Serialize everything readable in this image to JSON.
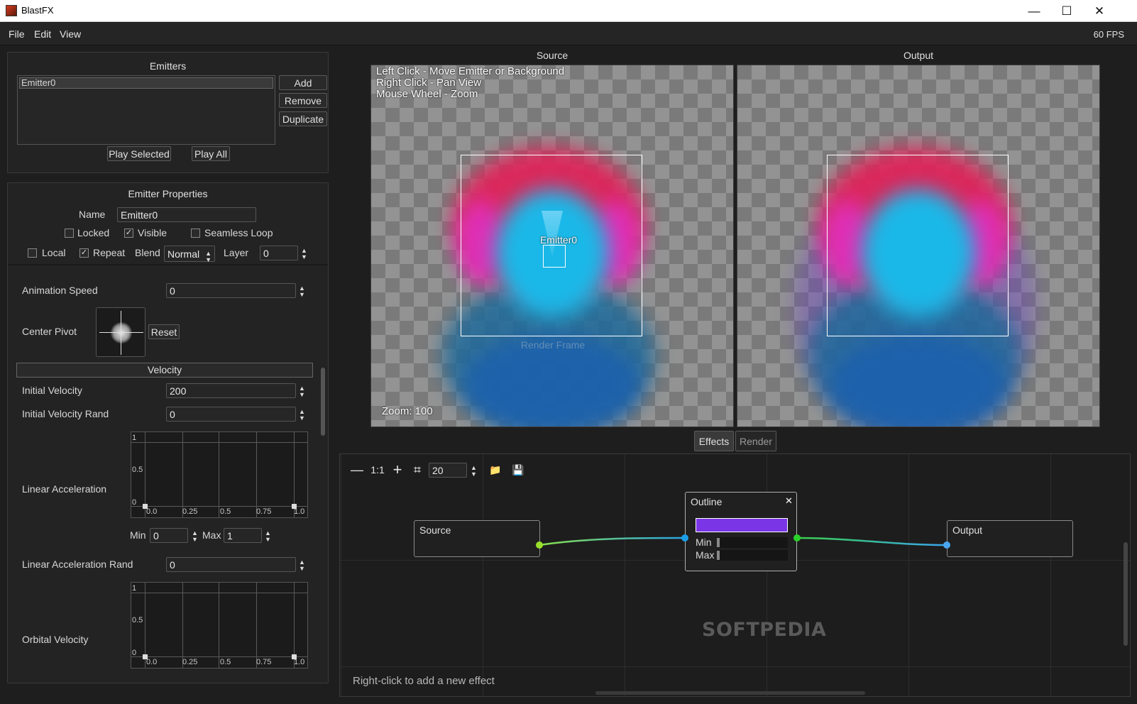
{
  "window": {
    "title": "BlastFX",
    "minimize": "—",
    "maximize": "☐",
    "close": "✕"
  },
  "menu": {
    "file": "File",
    "edit": "Edit",
    "view": "View",
    "fps": "60 FPS"
  },
  "emitters": {
    "title": "Emitters",
    "items": [
      "Emitter0"
    ],
    "add": "Add",
    "remove": "Remove",
    "duplicate": "Duplicate",
    "play_selected": "Play Selected",
    "play_all": "Play All"
  },
  "props": {
    "title": "Emitter Properties",
    "name_label": "Name",
    "name_value": "Emitter0",
    "locked": "Locked",
    "visible": "Visible",
    "seamless_loop": "Seamless Loop",
    "locked_checked": false,
    "visible_checked": true,
    "seamless_checked": false,
    "local": "Local",
    "repeat": "Repeat",
    "local_checked": false,
    "repeat_checked": true,
    "blend_label": "Blend",
    "blend_value": "Normal",
    "layer_label": "Layer",
    "layer_value": "0",
    "anim_speed_label": "Animation Speed",
    "anim_speed_value": "0",
    "center_pivot_label": "Center Pivot",
    "reset": "Reset",
    "velocity_header": "Velocity",
    "init_vel_label": "Initial Velocity",
    "init_vel_value": "200",
    "init_vel_rand_label": "Initial Velocity Rand",
    "init_vel_rand_value": "0",
    "lin_acc_label": "Linear Acceleration",
    "min_label": "Min",
    "min_value": "0",
    "max_label": "Max",
    "max_value": "1",
    "lin_acc_rand_label": "Linear Acceleration Rand",
    "lin_acc_rand_value": "0",
    "orbital_label": "Orbital Velocity",
    "graph_y": [
      "1",
      "0.5",
      "0"
    ],
    "graph_x": [
      "0.0",
      "0.25",
      "0.5",
      "0.75",
      "1.0"
    ]
  },
  "source_view": {
    "title": "Source",
    "hints": [
      "Left Click - Move Emitter or Background",
      "Right Click - Pan View",
      "Mouse Wheel - Zoom"
    ],
    "emitter_label": "Emitter0",
    "render_frame": "Render Frame",
    "zoom": "Zoom: 100"
  },
  "output_view": {
    "title": "Output"
  },
  "tabs": {
    "effects": "Effects",
    "render": "Render"
  },
  "graph_editor": {
    "toolbar": {
      "zoom_out": "—",
      "reset": "1:1",
      "zoom_in": "+",
      "grid": "⌗",
      "grid_value": "20",
      "open": "📁",
      "save": "💾"
    },
    "nodes": {
      "source": "Source",
      "outline": "Outline",
      "output": "Output",
      "close": "✕",
      "min": "Min",
      "max": "Max",
      "outline_color": "#7a35e6"
    },
    "hint": "Right-click to add a new effect",
    "watermark": "SOFTPEDIA"
  }
}
